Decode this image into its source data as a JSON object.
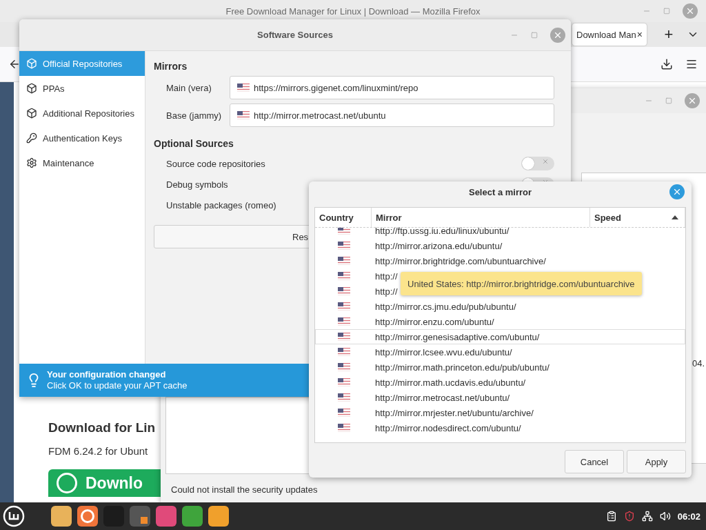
{
  "browser": {
    "title": "Free Download Manager for Linux | Download — Mozilla Firefox",
    "tab": {
      "label": "Download Man",
      "close": "×"
    },
    "new_tab": "+"
  },
  "web_page": {
    "heading": "Download for Lin",
    "subtitle": "FDM 6.24.2 for Ubunt",
    "download_button": "Downlo"
  },
  "update_manager": {
    "status": "Could not install the security updates",
    "cell": "04."
  },
  "software_sources": {
    "title": "Software Sources",
    "sidebar": [
      {
        "label": "Official Repositories",
        "selected": true
      },
      {
        "label": "PPAs",
        "selected": false
      },
      {
        "label": "Additional Repositories",
        "selected": false
      },
      {
        "label": "Authentication Keys",
        "selected": false
      },
      {
        "label": "Maintenance",
        "selected": false
      }
    ],
    "mirrors_heading": "Mirrors",
    "mirrors": [
      {
        "label": "Main (vera)",
        "value": "https://mirrors.gigenet.com/linuxmint/repo"
      },
      {
        "label": "Base (jammy)",
        "value": "http://mirror.metrocast.net/ubuntu"
      }
    ],
    "optional_heading": "Optional Sources",
    "optional": [
      {
        "label": "Source code repositories",
        "on": false
      },
      {
        "label": "Debug symbols",
        "on": false
      },
      {
        "label": "Unstable packages (romeo)"
      }
    ],
    "button": "Res",
    "info": {
      "title": "Your configuration changed",
      "message": "Click OK to update your APT cache"
    }
  },
  "mirror_dialog": {
    "title": "Select a mirror",
    "columns": [
      "Country",
      "Mirror",
      "Speed"
    ],
    "sorted_ascending": true,
    "rows": [
      {
        "mirror": "http://ftp.ussg.iu.edu/linux/ubuntu/",
        "selected": false
      },
      {
        "mirror": "http://mirror.arizona.edu/ubuntu/",
        "selected": false
      },
      {
        "mirror": "http://mirror.brightridge.com/ubuntuarchive/",
        "selected": false
      },
      {
        "mirror": "http://",
        "selected": false
      },
      {
        "mirror": "http://",
        "selected": false
      },
      {
        "mirror": "http://mirror.cs.jmu.edu/pub/ubuntu/",
        "selected": false
      },
      {
        "mirror": "http://mirror.enzu.com/ubuntu/",
        "selected": false
      },
      {
        "mirror": "http://mirror.genesisadaptive.com/ubuntu/",
        "selected": true
      },
      {
        "mirror": "http://mirror.lcsee.wvu.edu/ubuntu/",
        "selected": false
      },
      {
        "mirror": "http://mirror.math.princeton.edu/pub/ubuntu/",
        "selected": false
      },
      {
        "mirror": "http://mirror.math.ucdavis.edu/ubuntu/",
        "selected": false
      },
      {
        "mirror": "http://mirror.metrocast.net/ubuntu/",
        "selected": false
      },
      {
        "mirror": "http://mirror.mrjester.net/ubuntu/archive/",
        "selected": false
      },
      {
        "mirror": "http://mirror.nodesdirect.com/ubuntu/",
        "selected": false
      }
    ],
    "tooltip": "United States: http://mirror.brightridge.com/ubuntuarchive",
    "buttons": [
      "Cancel",
      "Apply"
    ]
  },
  "taskbar": {
    "clock": "06:02"
  }
}
